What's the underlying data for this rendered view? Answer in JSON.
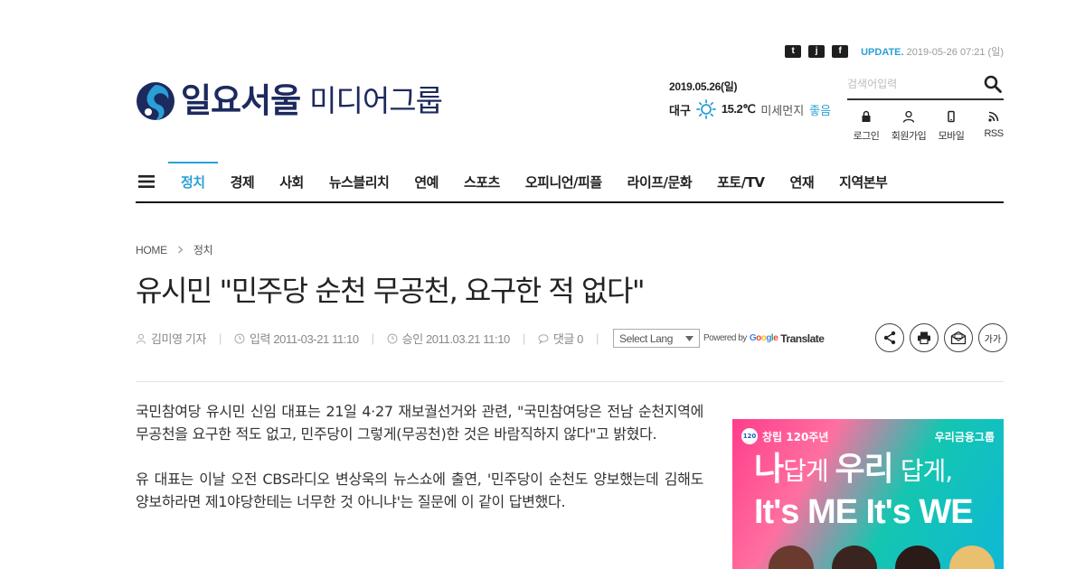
{
  "topbar": {
    "social_icons": [
      "twitter-icon",
      "tumblr-icon",
      "facebook-icon"
    ],
    "social_glyphs": [
      "t",
      "j",
      "f"
    ],
    "update_label": "UPDATE.",
    "update_datetime": " 2019-05-26 07:21 (일)"
  },
  "logo": {
    "main": "일요서울",
    "sub": "미디어그룹"
  },
  "weather": {
    "date": "2019.05.26(일)",
    "city": "대구",
    "temp": "15.2℃",
    "dust_label": "미세먼지",
    "dust_status": "좋음"
  },
  "search": {
    "placeholder": "검색어입력"
  },
  "utils": [
    {
      "label": "로그인",
      "icon": "lock-icon"
    },
    {
      "label": "회원가입",
      "icon": "user-icon"
    },
    {
      "label": "모바일",
      "icon": "mobile-icon"
    },
    {
      "label": "RSS",
      "icon": "rss-icon"
    }
  ],
  "nav": {
    "items": [
      {
        "label": "정치",
        "active": true
      },
      {
        "label": "경제"
      },
      {
        "label": "사회"
      },
      {
        "label": "뉴스블리치"
      },
      {
        "label": "연예"
      },
      {
        "label": "스포츠"
      },
      {
        "label": "오피니언/피플"
      },
      {
        "label": "라이프/문화"
      },
      {
        "label": "포토/TV"
      },
      {
        "label": "연재"
      },
      {
        "label": "지역본부"
      }
    ]
  },
  "breadcrumb": {
    "home": "HOME",
    "section": "정치"
  },
  "article": {
    "title": "유시민 \"민주당 순천 무공천, 요구한 적 없다\"",
    "author": "김미영 기자",
    "input_time": "입력 2011-03-21 11:10",
    "approve_time": "승인 2011.03.21 11:10",
    "comments": "댓글 0",
    "lang_select": "Select Lang",
    "powered_by": "Powered by",
    "google": "Google",
    "translate": "Translate",
    "font_size_label": "가가",
    "paragraphs": [
      "국민참여당 유시민 신임 대표는 21일 4·27 재보궐선거와 관련, \"국민참여당은 전남 순천지역에 무공천을 요구한 적도 없고, 민주당이 그렇게(무공천)한 것은 바람직하지 않다\"고 밝혔다.",
      "유 대표는 이날 오전 CBS라디오 변상욱의 뉴스쇼에 출연, '민주당이 순천도 양보했는데 김해도 양보하라면 제1야당한테는 너무한 것 아니냐'는 질문에 이 같이 답변했다."
    ]
  },
  "ad": {
    "anniversary": "창립 120주년",
    "badge": "120",
    "brand": "우리금융그룹",
    "line1_a": "나",
    "line1_b": "답게 ",
    "line1_c": "우리",
    "line1_d": " 답게,",
    "line2": "It's ME It's WE"
  },
  "colors": {
    "accent": "#2a9fd6",
    "logo": "#1c2a5e"
  }
}
